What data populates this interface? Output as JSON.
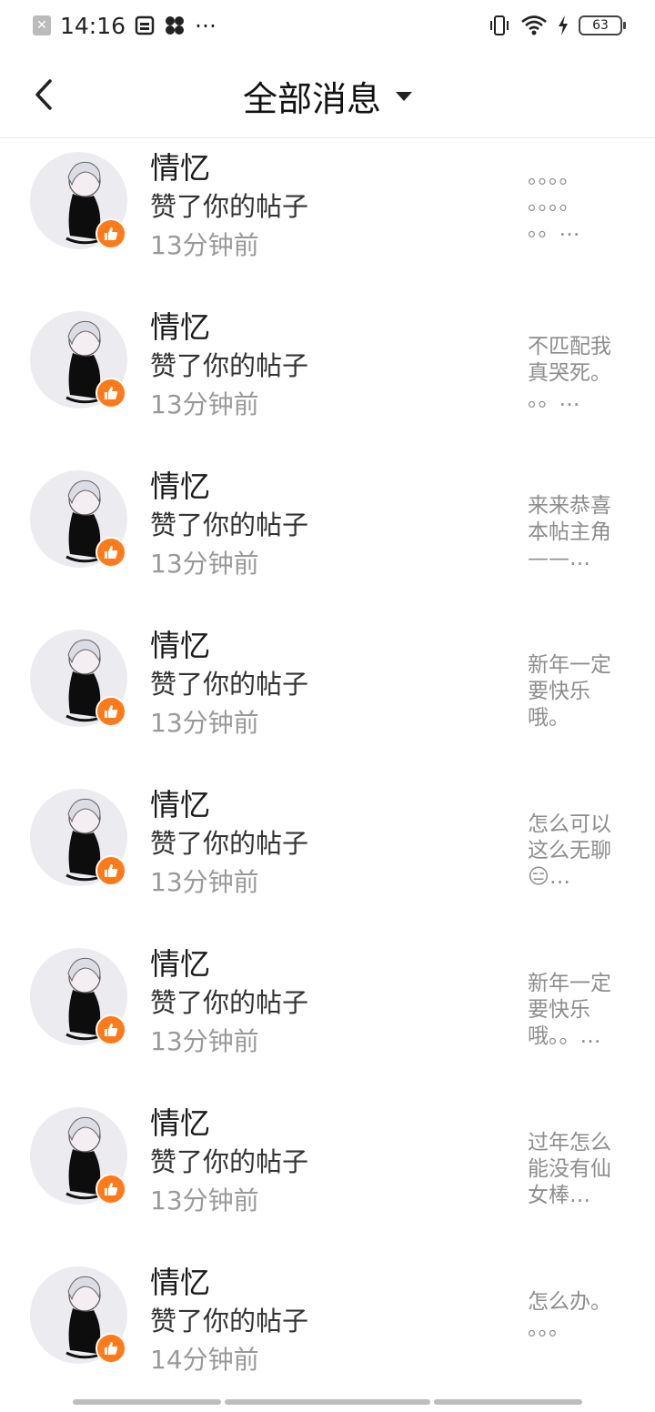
{
  "status_bar": {
    "time": "14:16",
    "dots": "···",
    "battery": "63",
    "icons": [
      "notification-x-icon",
      "sim-card-icon",
      "fan-icon",
      "vibrate-icon",
      "wifi-icon",
      "charging-icon",
      "battery-icon"
    ]
  },
  "header": {
    "title": "全部消息"
  },
  "messages": [
    {
      "name": "情忆",
      "action": "赞了你的帖子",
      "time": "13分钟前",
      "preview": "。。。。\n。。。。\n。。…"
    },
    {
      "name": "情忆",
      "action": "赞了你的帖子",
      "time": "13分钟前",
      "preview": "不匹配我\n真哭死。\n。。…"
    },
    {
      "name": "情忆",
      "action": "赞了你的帖子",
      "time": "13分钟前",
      "preview": "来来恭喜\n本帖主角\n——…"
    },
    {
      "name": "情忆",
      "action": "赞了你的帖子",
      "time": "13分钟前",
      "preview": "新年一定\n要快乐\n哦。"
    },
    {
      "name": "情忆",
      "action": "赞了你的帖子",
      "time": "13分钟前",
      "preview": "怎么可以\n这么无聊\n😑…"
    },
    {
      "name": "情忆",
      "action": "赞了你的帖子",
      "time": "13分钟前",
      "preview": "新年一定\n要快乐\n哦。。…"
    },
    {
      "name": "情忆",
      "action": "赞了你的帖子",
      "time": "13分钟前",
      "preview": "过年怎么\n能没有仙\n女棒…"
    },
    {
      "name": "情忆",
      "action": "赞了你的帖子",
      "time": "14分钟前",
      "preview": "怎么办。\n。。。"
    }
  ],
  "colors": {
    "badge": "#ff7a1a",
    "muted_text": "#999999"
  }
}
